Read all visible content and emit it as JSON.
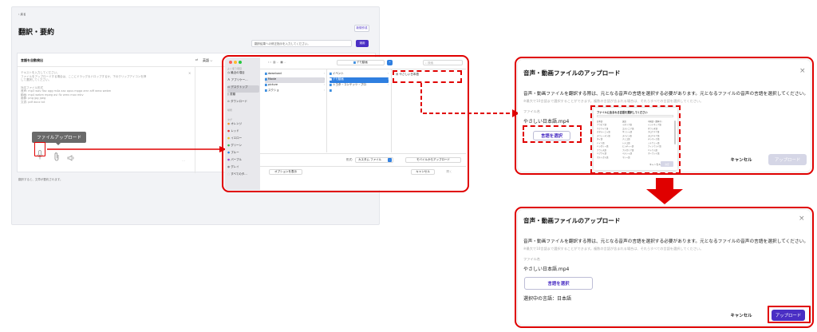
{
  "app": {
    "back": "‹ 戻る",
    "title": "翻訳・要約",
    "top_button": "新規作成",
    "instruction_placeholder": "翻訳結果への修正指示を入力してください。",
    "instruction_button": "適用",
    "auto_detect": "言語を自動検出",
    "target_lang": "英語 ⌵",
    "input_hint": [
      "テキストを入力してください。",
      "ファイルをアップロードする場合は、ここにドラッグ＆ドロップするか、下のクリップアイコンを押",
      "して選択してください。"
    ],
    "supported_title": "対応ファイル形式",
    "supported": [
      "音声: mp3 wav flac ogg m4a aac opus mpga amr aiff wma webm",
      "動画: mp4 webm mpeg avi flv wmv mov mkv",
      "画像: png jpg jpeg",
      "文書: pdf docx txt"
    ],
    "tooltip": "ファイルアップロード",
    "footer": "翻訳すると、文章が要約されます。"
  },
  "dialog": {
    "sidebar": {
      "fav_title": "よく使う項目",
      "fav": [
        "最近の項目",
        "アプリケー…",
        "デスクトップ",
        "書類",
        "ダウンロード"
      ],
      "loc_title": "場所",
      "tag_title": "タグ",
      "tags": [
        {
          "label": "オレンジ",
          "color": "#f0932a"
        },
        {
          "label": "レッド",
          "color": "#e33333"
        },
        {
          "label": "イエロー",
          "color": "#e9c51b"
        },
        {
          "label": "グリーン",
          "color": "#3bb84a"
        },
        {
          "label": "ブルー",
          "color": "#2f7fe0"
        },
        {
          "label": "パープル",
          "color": "#9b4fcf"
        },
        {
          "label": "グレイ",
          "color": "#8e8e93"
        },
        {
          "label": "すべてのタ…",
          "color": ""
        }
      ]
    },
    "path": "デモ動画",
    "search": "検索",
    "col1": [
      "download",
      "Movie",
      "picture",
      "スクショ"
    ],
    "col2": [
      "イベント",
      "デモ動画",
      "トヨタ・コンテッツ・プロ",
      ""
    ],
    "col3": [
      "やさしい日本語"
    ],
    "format_label": "形式:",
    "format_value": "カスタム ファイル",
    "mobile_button": "モバイルからアップロード",
    "options_button": "オプションを表示",
    "cancel": "キャンセル",
    "open": "開く"
  },
  "modal_a": {
    "title": "音声・動画ファイルのアップロード",
    "desc": "音声・動画ファイルを翻訳する際は、元となる音声の言語を選択する必要があります。元となるファイルの音声の言語を選択してください。",
    "note": "※最大で10言語まで選択することができます。複数の言語が含まれる場合は、それらすべての言語を選択してください。",
    "file_label": "ファイル名",
    "file_name": "やさしい日本語.mp4",
    "select_button": "言語を選択",
    "popup_title": "ファイルに含まれる言語を選択してください",
    "popup_langs": [
      "日本語",
      "英語",
      "中国語（簡体字）",
      "アラビア語",
      "イタリア語",
      "インドネシア語",
      "ウクライナ語",
      "エストニア語",
      "オランダ語",
      "カタルーニャ語",
      "ギリシャ語",
      "クロアチア語",
      "スウェーデン語",
      "スペイン語",
      "スロバキア語",
      "タイ語",
      "チェコ語",
      "デンマーク語",
      "ドイツ語",
      "トルコ語",
      "ノルウェー語",
      "ハンガリー語",
      "ヒンディー語",
      "フィンランド語",
      "フランス語",
      "ブルガリア語",
      "ベトナム語",
      "ヘブライ語",
      "ペルシャ語",
      "ポーランド語",
      "ポルトガル語",
      "マレー語"
    ],
    "popup_cancel": "キャンセル",
    "popup_ok": "決定",
    "cancel": "キャンセル",
    "upload": "アップロード"
  },
  "modal_b": {
    "title": "音声・動画ファイルのアップロード",
    "desc": "音声・動画ファイルを翻訳する際は、元となる音声の言語を選択する必要があります。元となるファイルの音声の言語を選択してください。",
    "note": "※最大で10言語まで選択することができます。複数の言語が含まれる場合は、それらすべての言語を選択してください。",
    "file_label": "ファイル名",
    "file_name": "やさしい日本語.mp4",
    "select_button": "言語を選択",
    "selected": "選択中の言語：日本語",
    "cancel": "キャンセル",
    "upload": "アップロード"
  },
  "colors": {
    "accent": "#4a2fc4",
    "annotation": "#e00000",
    "folder": "#3d8fe0"
  }
}
